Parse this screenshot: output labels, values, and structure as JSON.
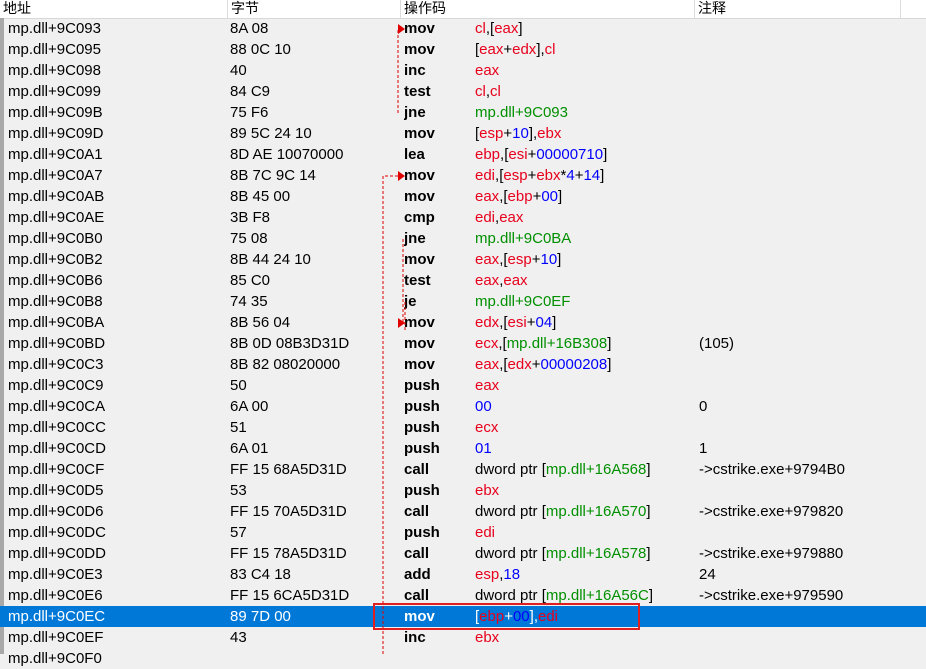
{
  "columns": [
    "地址",
    "字节",
    "操作码",
    "注释"
  ],
  "colors": {
    "register": "#e8001c",
    "number": "#0000ff",
    "symbol": "#009000",
    "selection": "#0078d7",
    "arrow": "#e00000",
    "highlight_box": "#e02020"
  },
  "rows": [
    {
      "addr": "mp.dll+9C093",
      "bytes": "8A 08",
      "mn": "mov",
      "ops": [
        [
          "cl",
          "reg"
        ],
        [
          ",[",
          "txt"
        ],
        [
          "eax",
          "reg"
        ],
        [
          "]",
          "txt"
        ]
      ],
      "comment": ""
    },
    {
      "addr": "mp.dll+9C095",
      "bytes": "88 0C 10",
      "mn": "mov",
      "ops": [
        [
          "[",
          "txt"
        ],
        [
          "eax",
          "reg"
        ],
        [
          "+",
          "txt"
        ],
        [
          "edx",
          "reg"
        ],
        [
          "],",
          "txt"
        ],
        [
          "cl",
          "reg"
        ]
      ],
      "comment": ""
    },
    {
      "addr": "mp.dll+9C098",
      "bytes": "40",
      "mn": "inc",
      "ops": [
        [
          "eax",
          "reg"
        ]
      ],
      "comment": ""
    },
    {
      "addr": "mp.dll+9C099",
      "bytes": "84 C9",
      "mn": "test",
      "ops": [
        [
          "cl",
          "reg"
        ],
        [
          ",",
          "txt"
        ],
        [
          "cl",
          "reg"
        ]
      ],
      "comment": ""
    },
    {
      "addr": "mp.dll+9C09B",
      "bytes": "75 F6",
      "mn": "jne",
      "ops": [
        [
          "mp.dll+9C093",
          "sym"
        ]
      ],
      "comment": ""
    },
    {
      "addr": "mp.dll+9C09D",
      "bytes": "89 5C 24 10",
      "mn": "mov",
      "ops": [
        [
          "[",
          "txt"
        ],
        [
          "esp",
          "reg"
        ],
        [
          "+",
          "txt"
        ],
        [
          "10",
          "num"
        ],
        [
          "],",
          "txt"
        ],
        [
          "ebx",
          "reg"
        ]
      ],
      "comment": ""
    },
    {
      "addr": "mp.dll+9C0A1",
      "bytes": "8D AE 10070000",
      "mn": "lea",
      "ops": [
        [
          "ebp",
          "reg"
        ],
        [
          ",[",
          "txt"
        ],
        [
          "esi",
          "reg"
        ],
        [
          "+",
          "txt"
        ],
        [
          "00000710",
          "num"
        ],
        [
          "]",
          "txt"
        ]
      ],
      "comment": ""
    },
    {
      "addr": "mp.dll+9C0A7",
      "bytes": "8B 7C 9C 14",
      "mn": "mov",
      "ops": [
        [
          "edi",
          "reg"
        ],
        [
          ",[",
          "txt"
        ],
        [
          "esp",
          "reg"
        ],
        [
          "+",
          "txt"
        ],
        [
          "ebx",
          "reg"
        ],
        [
          "*",
          "txt"
        ],
        [
          "4",
          "num"
        ],
        [
          "+",
          "txt"
        ],
        [
          "14",
          "num"
        ],
        [
          "]",
          "txt"
        ]
      ],
      "comment": ""
    },
    {
      "addr": "mp.dll+9C0AB",
      "bytes": "8B 45 00",
      "mn": "mov",
      "ops": [
        [
          "eax",
          "reg"
        ],
        [
          ",[",
          "txt"
        ],
        [
          "ebp",
          "reg"
        ],
        [
          "+",
          "txt"
        ],
        [
          "00",
          "num"
        ],
        [
          "]",
          "txt"
        ]
      ],
      "comment": ""
    },
    {
      "addr": "mp.dll+9C0AE",
      "bytes": "3B F8",
      "mn": "cmp",
      "ops": [
        [
          "edi",
          "reg"
        ],
        [
          ",",
          "txt"
        ],
        [
          "eax",
          "reg"
        ]
      ],
      "comment": ""
    },
    {
      "addr": "mp.dll+9C0B0",
      "bytes": "75 08",
      "mn": "jne",
      "ops": [
        [
          "mp.dll+9C0BA",
          "sym"
        ]
      ],
      "comment": ""
    },
    {
      "addr": "mp.dll+9C0B2",
      "bytes": "8B 44 24 10",
      "mn": "mov",
      "ops": [
        [
          "eax",
          "reg"
        ],
        [
          ",[",
          "txt"
        ],
        [
          "esp",
          "reg"
        ],
        [
          "+",
          "txt"
        ],
        [
          "10",
          "num"
        ],
        [
          "]",
          "txt"
        ]
      ],
      "comment": ""
    },
    {
      "addr": "mp.dll+9C0B6",
      "bytes": "85 C0",
      "mn": "test",
      "ops": [
        [
          "eax",
          "reg"
        ],
        [
          ",",
          "txt"
        ],
        [
          "eax",
          "reg"
        ]
      ],
      "comment": ""
    },
    {
      "addr": "mp.dll+9C0B8",
      "bytes": "74 35",
      "mn": "je",
      "ops": [
        [
          "mp.dll+9C0EF",
          "sym"
        ]
      ],
      "comment": ""
    },
    {
      "addr": "mp.dll+9C0BA",
      "bytes": "8B 56 04",
      "mn": "mov",
      "ops": [
        [
          "edx",
          "reg"
        ],
        [
          ",[",
          "txt"
        ],
        [
          "esi",
          "reg"
        ],
        [
          "+",
          "txt"
        ],
        [
          "04",
          "num"
        ],
        [
          "]",
          "txt"
        ]
      ],
      "comment": ""
    },
    {
      "addr": "mp.dll+9C0BD",
      "bytes": "8B 0D 08B3D31D",
      "mn": "mov",
      "ops": [
        [
          "ecx",
          "reg"
        ],
        [
          ",[",
          "txt"
        ],
        [
          "mp.dll+16B308",
          "sym"
        ],
        [
          "]",
          "txt"
        ]
      ],
      "comment": "(105)"
    },
    {
      "addr": "mp.dll+9C0C3",
      "bytes": "8B 82 08020000",
      "mn": "mov",
      "ops": [
        [
          "eax",
          "reg"
        ],
        [
          ",[",
          "txt"
        ],
        [
          "edx",
          "reg"
        ],
        [
          "+",
          "txt"
        ],
        [
          "00000208",
          "num"
        ],
        [
          "]",
          "txt"
        ]
      ],
      "comment": ""
    },
    {
      "addr": "mp.dll+9C0C9",
      "bytes": "50",
      "mn": "push",
      "ops": [
        [
          "eax",
          "reg"
        ]
      ],
      "comment": ""
    },
    {
      "addr": "mp.dll+9C0CA",
      "bytes": "6A 00",
      "mn": "push",
      "ops": [
        [
          "00",
          "num"
        ]
      ],
      "comment": "0"
    },
    {
      "addr": "mp.dll+9C0CC",
      "bytes": "51",
      "mn": "push",
      "ops": [
        [
          "ecx",
          "reg"
        ]
      ],
      "comment": ""
    },
    {
      "addr": "mp.dll+9C0CD",
      "bytes": "6A 01",
      "mn": "push",
      "ops": [
        [
          "01",
          "num"
        ]
      ],
      "comment": "1"
    },
    {
      "addr": "mp.dll+9C0CF",
      "bytes": "FF 15 68A5D31D",
      "mn": "call",
      "ops": [
        [
          "dword ptr [",
          "txt"
        ],
        [
          "mp.dll+16A568",
          "sym"
        ],
        [
          "]",
          "txt"
        ]
      ],
      "comment": "->cstrike.exe+9794B0"
    },
    {
      "addr": "mp.dll+9C0D5",
      "bytes": "53",
      "mn": "push",
      "ops": [
        [
          "ebx",
          "reg"
        ]
      ],
      "comment": ""
    },
    {
      "addr": "mp.dll+9C0D6",
      "bytes": "FF 15 70A5D31D",
      "mn": "call",
      "ops": [
        [
          "dword ptr [",
          "txt"
        ],
        [
          "mp.dll+16A570",
          "sym"
        ],
        [
          "]",
          "txt"
        ]
      ],
      "comment": "->cstrike.exe+979820"
    },
    {
      "addr": "mp.dll+9C0DC",
      "bytes": "57",
      "mn": "push",
      "ops": [
        [
          "edi",
          "reg"
        ]
      ],
      "comment": ""
    },
    {
      "addr": "mp.dll+9C0DD",
      "bytes": "FF 15 78A5D31D",
      "mn": "call",
      "ops": [
        [
          "dword ptr [",
          "txt"
        ],
        [
          "mp.dll+16A578",
          "sym"
        ],
        [
          "]",
          "txt"
        ]
      ],
      "comment": "->cstrike.exe+979880"
    },
    {
      "addr": "mp.dll+9C0E3",
      "bytes": "83 C4 18",
      "mn": "add",
      "ops": [
        [
          "esp",
          "reg"
        ],
        [
          ",",
          "txt"
        ],
        [
          "18",
          "num"
        ]
      ],
      "comment": "24"
    },
    {
      "addr": "mp.dll+9C0E6",
      "bytes": "FF 15 6CA5D31D",
      "mn": "call",
      "ops": [
        [
          "dword ptr [",
          "txt"
        ],
        [
          "mp.dll+16A56C",
          "sym"
        ],
        [
          "]",
          "txt"
        ]
      ],
      "comment": "->cstrike.exe+979590"
    },
    {
      "addr": "mp.dll+9C0EC",
      "bytes": "89 7D 00",
      "mn": "mov",
      "ops": [
        [
          "[",
          "txt"
        ],
        [
          "ebp",
          "reg"
        ],
        [
          "+",
          "txt"
        ],
        [
          "00",
          "num"
        ],
        [
          "],",
          "txt"
        ],
        [
          "edi",
          "reg"
        ]
      ],
      "comment": "",
      "selected": true
    },
    {
      "addr": "mp.dll+9C0EF",
      "bytes": "43",
      "mn": "inc",
      "ops": [
        [
          "ebx",
          "reg"
        ]
      ],
      "comment": ""
    },
    {
      "addr": "mp.dll+9C0F0",
      "bytes": "",
      "mn": "",
      "ops": [],
      "comment": ""
    }
  ]
}
